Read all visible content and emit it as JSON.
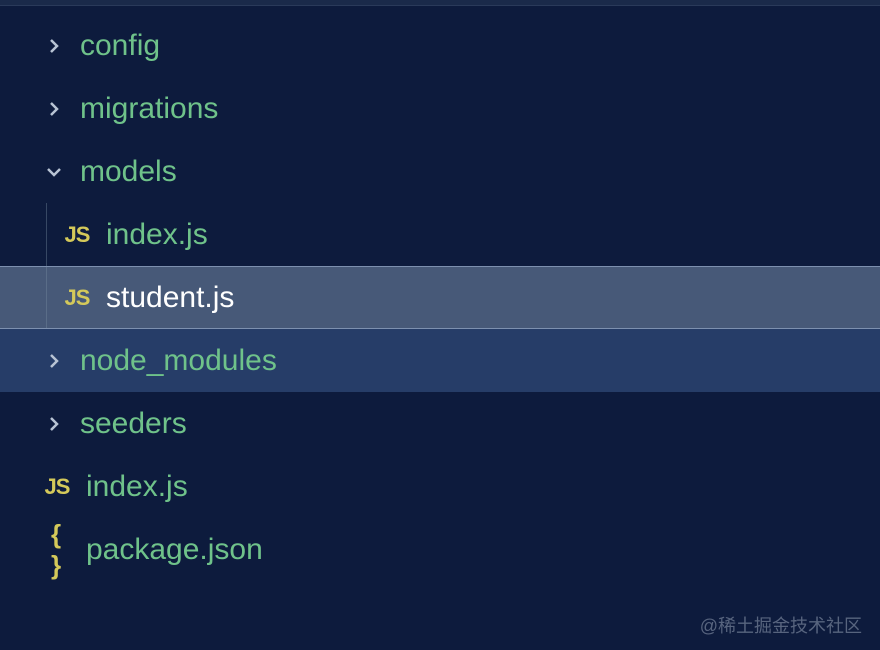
{
  "icons": {
    "js": "JS",
    "json": "{ }"
  },
  "tree": {
    "items": [
      {
        "type": "folder",
        "label": "config",
        "expanded": false,
        "indent": 1
      },
      {
        "type": "folder",
        "label": "migrations",
        "expanded": false,
        "indent": 1
      },
      {
        "type": "folder",
        "label": "models",
        "expanded": true,
        "indent": 1
      },
      {
        "type": "file",
        "label": "index.js",
        "icon": "js",
        "indent": 2
      },
      {
        "type": "file",
        "label": "student.js",
        "icon": "js",
        "indent": 2,
        "selected": true
      },
      {
        "type": "folder",
        "label": "node_modules",
        "expanded": false,
        "indent": 1,
        "hovered": true
      },
      {
        "type": "folder",
        "label": "seeders",
        "expanded": false,
        "indent": 1
      },
      {
        "type": "file",
        "label": "index.js",
        "icon": "js",
        "indent": 1
      },
      {
        "type": "file",
        "label": "package.json",
        "icon": "json",
        "indent": 1
      }
    ]
  },
  "watermark": "@稀土掘金技术社区"
}
